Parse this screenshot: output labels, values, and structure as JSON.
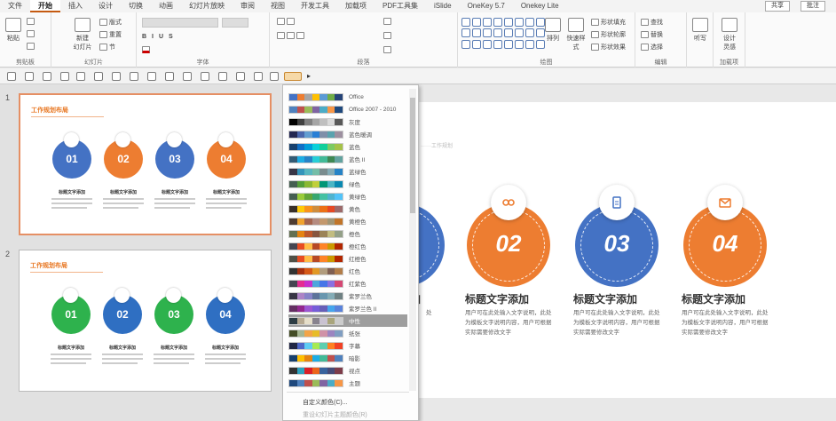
{
  "ribbon": {
    "tabs": [
      "文件",
      "开始",
      "插入",
      "设计",
      "切换",
      "动画",
      "幻灯片放映",
      "审阅",
      "视图",
      "开发工具",
      "加载项",
      "PDF工具集",
      "iSlide",
      "OneKey 5.7",
      "Onekey Lite"
    ],
    "active_tab": 1,
    "window_btns": [
      "共享",
      "批注"
    ],
    "groups": {
      "clipboard": "剪贴板",
      "slides": "幻灯片",
      "font": "字体",
      "paragraph": "段落",
      "drawing": "绘图",
      "editing": "编辑",
      "addins": "加载项"
    },
    "buttons": {
      "paste": "粘贴",
      "new_slide": "新建\n幻灯片",
      "layout": "版式",
      "reset": "重置",
      "section": "节",
      "arrange": "排列",
      "quick_styles": "快速样式",
      "shape_fill": "形状填充",
      "shape_outline": "形状轮廓",
      "shape_effects": "形状效果",
      "find": "查找",
      "replace": "替换",
      "select": "选择",
      "voice": "听写",
      "designer": "设计\n灵感"
    }
  },
  "slides": [
    {
      "num": "1",
      "title": "工作规划布局",
      "items": [
        {
          "num": "01",
          "caption": "标题文字添加",
          "color": "#4472c4"
        },
        {
          "num": "02",
          "caption": "标题文字添加",
          "color": "#ed7d31"
        },
        {
          "num": "03",
          "caption": "标题文字添加",
          "color": "#4472c4"
        },
        {
          "num": "04",
          "caption": "标题文字添加",
          "color": "#ed7d31"
        }
      ]
    },
    {
      "num": "2",
      "title": "工作规划布局",
      "items": [
        {
          "num": "01",
          "caption": "标题文字添加",
          "color": "#2eb24d"
        },
        {
          "num": "02",
          "caption": "标题文字添加",
          "color": "#2f6fc2"
        },
        {
          "num": "03",
          "caption": "标题文字添加",
          "color": "#2eb24d"
        },
        {
          "num": "04",
          "caption": "标题文字添加",
          "color": "#2f6fc2"
        }
      ]
    }
  ],
  "main": {
    "subtitle": "······工作规划",
    "items": [
      {
        "num": "02",
        "caption": "标题文字添加",
        "color": "#ed7d31",
        "desc": "用户可在此处输入文字说明，此处为模板文字说明内容，用户可根据实际需要修改文字"
      },
      {
        "num": "03",
        "caption": "标题文字添加",
        "color": "#4472c4",
        "desc": "用户可在此处输入文字说明，此处为模板文字说明内容，用户可根据实际需要修改文字"
      },
      {
        "num": "04",
        "caption": "标题文字添加",
        "color": "#ed7d31",
        "desc": "用户可在此处输入文字说明，此处为模板文字说明内容，用户可根据实际需要修改文字"
      }
    ],
    "left_caption": "加",
    "left_desc": "处"
  },
  "color_menu": {
    "themes": [
      {
        "name": "Office",
        "colors": [
          "#4472c4",
          "#ed7d31",
          "#a5a5a5",
          "#ffc000",
          "#5b9bd5",
          "#70ad47",
          "#264478"
        ]
      },
      {
        "name": "Office 2007 - 2010",
        "colors": [
          "#4f81bd",
          "#c0504d",
          "#9bbb59",
          "#8064a2",
          "#4bacc6",
          "#f79646",
          "#1f497d"
        ]
      },
      {
        "name": "灰度",
        "colors": [
          "#000000",
          "#404040",
          "#7f7f7f",
          "#a5a5a5",
          "#bfbfbf",
          "#d9d9d9",
          "#595959"
        ]
      },
      {
        "name": "蓝色暖调",
        "colors": [
          "#242852",
          "#4a66ac",
          "#629dd1",
          "#297fd5",
          "#7f8fa9",
          "#5aa2ae",
          "#9d90a0"
        ]
      },
      {
        "name": "蓝色",
        "colors": [
          "#17406d",
          "#0f6fc6",
          "#009dd9",
          "#0bd0d9",
          "#10cf9b",
          "#7cca62",
          "#a5c249"
        ]
      },
      {
        "name": "蓝色 II",
        "colors": [
          "#335b74",
          "#1cade4",
          "#2683c6",
          "#27ced7",
          "#42ba97",
          "#3e8853",
          "#62a39f"
        ]
      },
      {
        "name": "蓝绿色",
        "colors": [
          "#373545",
          "#3494ba",
          "#58b6c0",
          "#75bda7",
          "#7a8c8e",
          "#84acb6",
          "#2683c6"
        ]
      },
      {
        "name": "绿色",
        "colors": [
          "#455f51",
          "#549e39",
          "#8ab833",
          "#c0cf3a",
          "#029676",
          "#4ab5c4",
          "#0989b1"
        ]
      },
      {
        "name": "黄绿色",
        "colors": [
          "#455f51",
          "#99cb38",
          "#63a537",
          "#37a76f",
          "#44c1a3",
          "#4eb3cf",
          "#51c3f9"
        ]
      },
      {
        "name": "黄色",
        "colors": [
          "#39302a",
          "#ffca08",
          "#f8931d",
          "#ce8d3e",
          "#ec7016",
          "#e64823",
          "#9c6a6a"
        ]
      },
      {
        "name": "黄橙色",
        "colors": [
          "#4e3b30",
          "#f0a22e",
          "#a5644e",
          "#b58b80",
          "#c3986d",
          "#a19574",
          "#c17529"
        ]
      },
      {
        "name": "橙色",
        "colors": [
          "#637052",
          "#e48312",
          "#bd582c",
          "#865640",
          "#9b8357",
          "#c2bc80",
          "#94a088"
        ]
      },
      {
        "name": "橙红色",
        "colors": [
          "#454551",
          "#e84c22",
          "#ffbd47",
          "#b64926",
          "#ff8427",
          "#cc9900",
          "#b22600"
        ]
      },
      {
        "name": "红橙色",
        "colors": [
          "#505046",
          "#e84c22",
          "#ffbd47",
          "#b64926",
          "#ff8427",
          "#cc9900",
          "#b22600"
        ]
      },
      {
        "name": "红色",
        "colors": [
          "#323232",
          "#a5300f",
          "#d55816",
          "#e19825",
          "#b19c7d",
          "#7f5f52",
          "#b27d49"
        ]
      },
      {
        "name": "红紫色",
        "colors": [
          "#454551",
          "#e32d91",
          "#c830cc",
          "#4ea6dc",
          "#4775e7",
          "#8971e1",
          "#d54773"
        ]
      },
      {
        "name": "紫罗兰色",
        "colors": [
          "#373545",
          "#ad84c6",
          "#8784c7",
          "#5d739a",
          "#6997af",
          "#84acb6",
          "#6f8183"
        ]
      },
      {
        "name": "紫罗兰色 II",
        "colors": [
          "#632e62",
          "#92278f",
          "#9b57d3",
          "#755dd9",
          "#665eb8",
          "#45a5ed",
          "#5982db"
        ]
      },
      {
        "name": "中性",
        "colors": [
          "#2c3c43",
          "#b6a991",
          "#e5dec9",
          "#88838e",
          "#c9c2d1",
          "#a9a57c",
          "#cccccc"
        ]
      },
      {
        "name": "纸张",
        "colors": [
          "#444d26",
          "#a5b592",
          "#f3a447",
          "#e7bc29",
          "#d092a7",
          "#9c85c0",
          "#809ec2"
        ]
      },
      {
        "name": "字幕",
        "colors": [
          "#212745",
          "#4e67c8",
          "#5eccf3",
          "#a7ea52",
          "#5dceaf",
          "#ff8021",
          "#f14124"
        ]
      },
      {
        "name": "暗影",
        "colors": [
          "#17406d",
          "#ffc000",
          "#e48312",
          "#1cade4",
          "#42ba97",
          "#c0504d",
          "#4f81bd"
        ]
      },
      {
        "name": "视点",
        "colors": [
          "#323232",
          "#2da2bf",
          "#da1f28",
          "#eb641b",
          "#39639d",
          "#474b78",
          "#7d3c4a"
        ]
      },
      {
        "name": "主题",
        "colors": [
          "#1f497d",
          "#4f81bd",
          "#c0504d",
          "#9bbb59",
          "#8064a2",
          "#4bacc6",
          "#f79646"
        ]
      }
    ],
    "highlight_index": 18,
    "customize": "自定义颜色(C)...",
    "reset": "重设幻灯片主题颜色(R)"
  }
}
